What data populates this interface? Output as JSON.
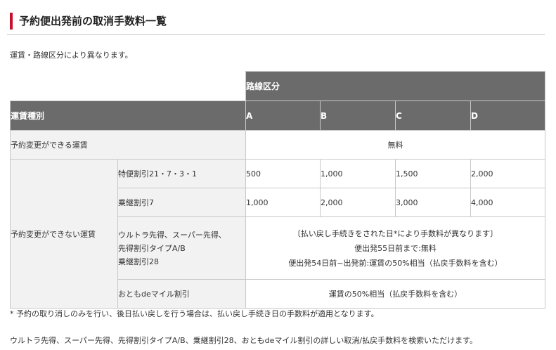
{
  "page": {
    "title": "予約便出発前の取消手数料一覧",
    "intro": "運賃・路線区分により異なります。"
  },
  "table": {
    "route_group_header": "路線区分",
    "fare_type_header": "運賃種別",
    "columns": [
      "A",
      "B",
      "C",
      "D"
    ],
    "changeable": {
      "label": "予約変更ができる運賃",
      "value": "無料"
    },
    "non_changeable": {
      "label": "予約変更ができない運賃",
      "rows": [
        {
          "name": "特便割引21・7・3・1",
          "values": [
            "500",
            "1,000",
            "1,500",
            "2,000"
          ]
        },
        {
          "name": "乗継割引7",
          "values": [
            "1,000",
            "2,000",
            "3,000",
            "4,000"
          ]
        }
      ],
      "ultra": {
        "name_lines": [
          "ウルトラ先得、スーパー先得、",
          "先得割引タイプA/B",
          "乗継割引28"
        ],
        "note_lines": [
          "〔払い戻し手続きをされた日*により手数料が異なります〕",
          "便出発55日前まで:無料",
          "便出発54日前~出発前:運賃の50%相当（払戻手数料を含む）"
        ]
      },
      "otomo": {
        "name": "おともdeマイル割引",
        "value": "運賃の50%相当（払戻手数料を含む）"
      }
    }
  },
  "footnote": "*  予約の取り消しのみを行い、後日払い戻しを行う場合は、払い戻し手続き日の手数料が適用となります。",
  "bottom_text": "ウルトラ先得、スーパー先得、先得割引タイプA/B、乗継割引28、おともdeマイル割引の詳しい取消/払戻手数料を検索いただけます。",
  "colors": {
    "accent": "#c8102e",
    "header_bg": "#6b6b6b",
    "row_label_bg": "#f2f2f2",
    "border": "#c8c8c8"
  }
}
